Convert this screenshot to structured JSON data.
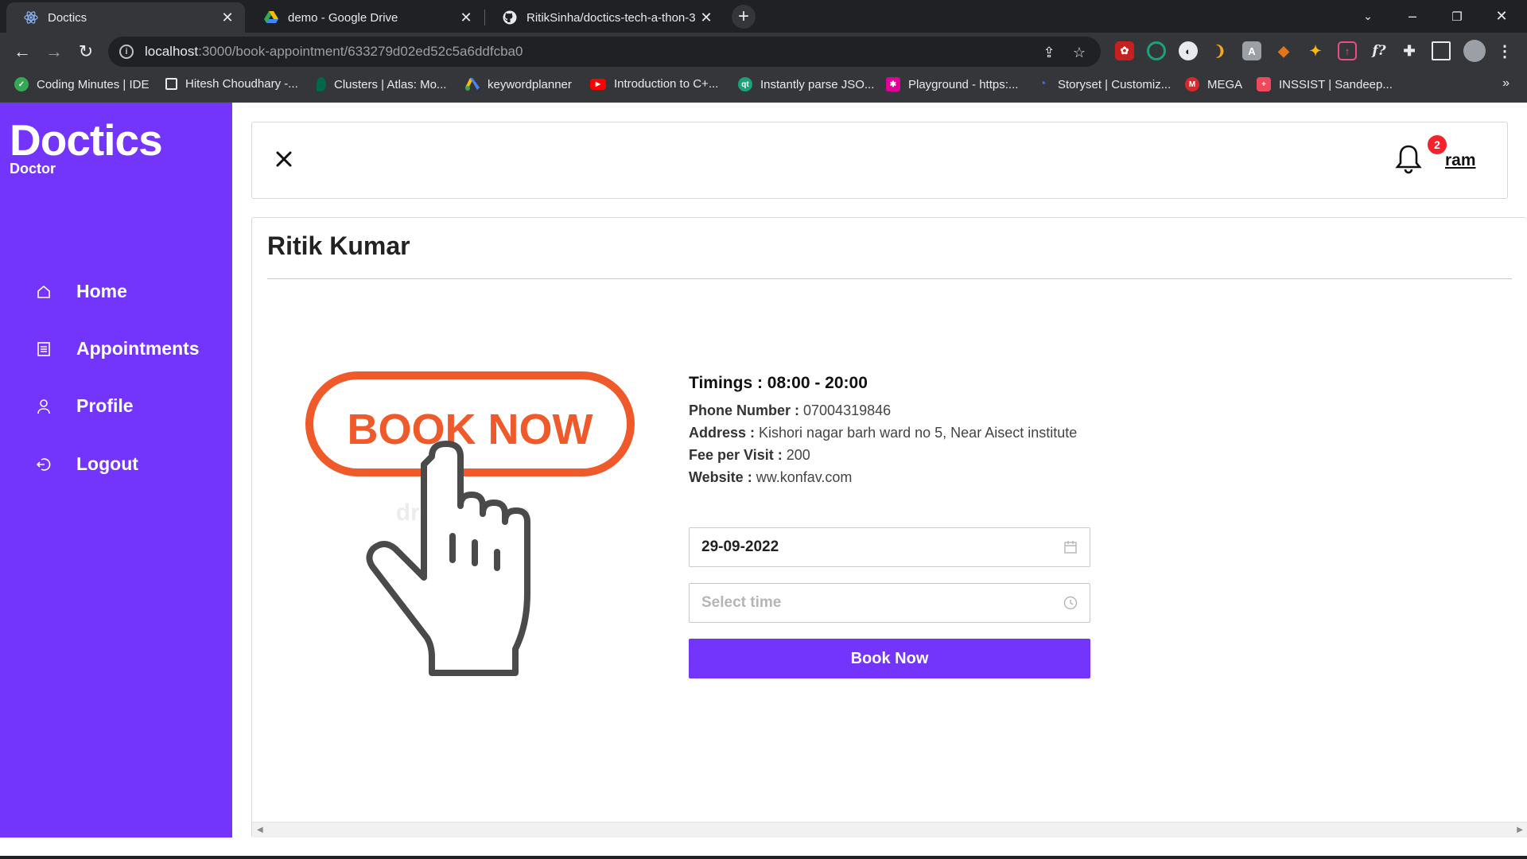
{
  "browser": {
    "tabs": [
      {
        "title": "Doctics",
        "icon": "react-icon",
        "active": true
      },
      {
        "title": "demo - Google Drive",
        "icon": "google-drive-icon",
        "active": false
      },
      {
        "title": "RitikSinha/doctics-tech-a-thon-3",
        "icon": "github-icon",
        "active": false
      }
    ],
    "url_host": "localhost",
    "url_path": ":3000/book-appointment/633279d02ed52c5a6ddfcba0",
    "bookmarks": [
      {
        "label": "Coding Minutes | IDE",
        "color": "#34a853"
      },
      {
        "label": "Hitesh Choudhary -...",
        "color": "#202124"
      },
      {
        "label": "Clusters | Atlas: Mo...",
        "color": "#00684a"
      },
      {
        "label": "keywordplanner",
        "color": "#4285f4"
      },
      {
        "label": "Introduction to C+...",
        "color": "#ff0000"
      },
      {
        "label": "Instantly parse JSO...",
        "color": "#1aa37a"
      },
      {
        "label": "Playground - https:...",
        "color": "#e10098"
      },
      {
        "label": "Storyset | Customiz...",
        "color": "#3c6ef0"
      },
      {
        "label": "MEGA",
        "color": "#d9272e"
      },
      {
        "label": "INSSIST | Sandeep...",
        "color": "#ef4a5b"
      }
    ]
  },
  "sidebar": {
    "logo": "Doctics",
    "role": "Doctor",
    "items": [
      {
        "label": "Home",
        "icon": "home-icon"
      },
      {
        "label": "Appointments",
        "icon": "list-icon"
      },
      {
        "label": "Profile",
        "icon": "user-icon"
      },
      {
        "label": "Logout",
        "icon": "logout-icon"
      }
    ]
  },
  "header": {
    "notification_count": "2",
    "username": "ram"
  },
  "doctor": {
    "name": "Ritik Kumar",
    "timings_label": "Timings :",
    "timings_value": " 08:00 - 20:00",
    "phone_label": "Phone Number :",
    "phone_value": " 07004319846",
    "address_label": "Address :",
    "address_value": " Kishori nagar barh ward no 5, Near Aisect institute",
    "fee_label": "Fee per Visit :",
    "fee_value": " 200",
    "website_label": "Website :",
    "website_value": " ww.konfav.com"
  },
  "illustration": {
    "text": "BOOK NOW",
    "watermark": "dreamstime"
  },
  "form": {
    "date_value": "29-09-2022",
    "time_placeholder": "Select time",
    "submit_label": "Book Now"
  },
  "colors": {
    "brand": "#7334fc",
    "illustration_orange": "#f05a2a",
    "badge": "#f5222d"
  }
}
